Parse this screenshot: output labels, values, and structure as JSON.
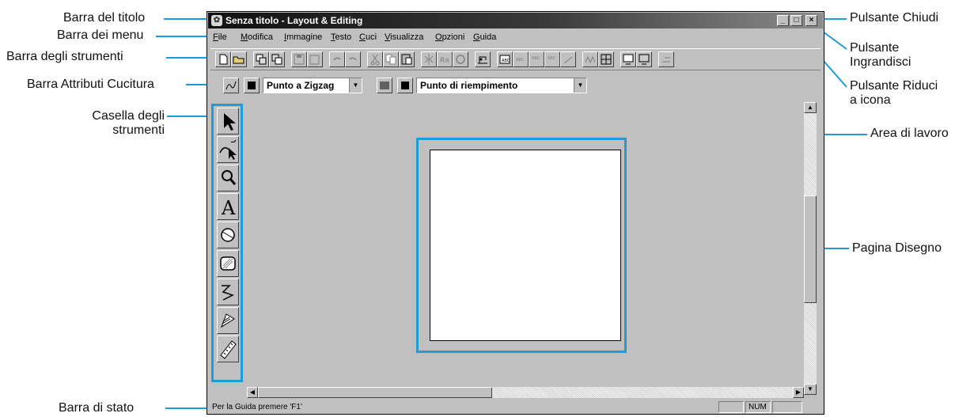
{
  "callouts": {
    "title_bar": "Barra del titolo",
    "menu_bar": "Barra dei menu",
    "toolbar": "Barra degli strumenti",
    "stitch_attr_bar": "Barra Attributi Cucitura",
    "toolbox_line1": "Casella degli",
    "toolbox_line2": "strumenti",
    "status_bar": "Barra di stato",
    "close_button": "Pulsante Chiudi",
    "maximize_line1": "Pulsante",
    "maximize_line2": "Ingrandisci",
    "minimize_line1": "Pulsante Riduci",
    "minimize_line2": "a icona",
    "work_area": "Area di lavoro",
    "design_page": "Pagina Disegno"
  },
  "window": {
    "title": "Senza titolo - Layout & Editing"
  },
  "menu": {
    "items": [
      {
        "first": "F",
        "rest": "ile"
      },
      {
        "first": "M",
        "rest": "odifica"
      },
      {
        "first": "I",
        "rest": "mmagine"
      },
      {
        "first": "T",
        "rest": "esto"
      },
      {
        "first": "C",
        "rest": "uci"
      },
      {
        "first": "V",
        "rest": "isualizza"
      },
      {
        "first": "O",
        "rest": "pzioni"
      },
      {
        "first": "G",
        "rest": "uida"
      }
    ]
  },
  "attributes": {
    "line_stitch": "Punto a Zigzag",
    "region_stitch": "Punto di riempimento"
  },
  "status": {
    "message": "Per la Guida premere 'F1'",
    "num": "NUM"
  },
  "colors": {
    "callout_line": "#1e9bd8",
    "window_face": "#c0c0c0"
  }
}
